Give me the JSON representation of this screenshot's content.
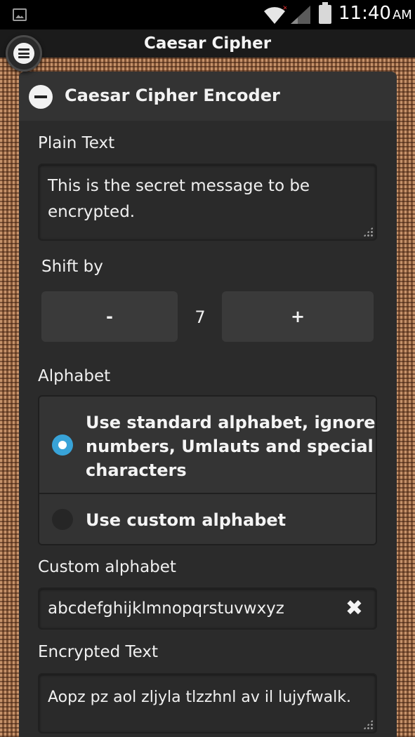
{
  "status_bar": {
    "time": "11:40",
    "ampm": "AM",
    "icons": [
      "image-icon",
      "wifi-icon",
      "signal-icon",
      "battery-icon"
    ]
  },
  "app_bar": {
    "title": "Caesar Cipher",
    "menu_icon": "menu-icon"
  },
  "encoder": {
    "title": "Caesar Cipher Encoder",
    "collapse_icon": "minus-icon",
    "plain_text_label": "Plain Text",
    "plain_text_line1": "This is the secret message to be",
    "plain_text_line2": "encrypted.",
    "shift_label": "Shift by",
    "minus_label": "-",
    "shift_value": "7",
    "plus_label": "+",
    "alphabet_label": "Alphabet",
    "options": [
      {
        "line1": "Use standard alphabet, ignore",
        "line2": "numbers, Umlauts and special",
        "line3": "characters",
        "selected": true
      },
      {
        "label": "Use custom alphabet",
        "selected": false
      }
    ],
    "custom_alphabet_label": "Custom alphabet",
    "custom_alphabet_value": "abcdefghijklmnopqrstuvwxyz",
    "clear_symbol": "✖",
    "encrypted_label": "Encrypted Text",
    "encrypted_value": "Aopz pz aol zljyla tlzzhnl av il lujyfwalk."
  },
  "colors": {
    "accent": "#38a3d8",
    "panel": "#2b2b2b",
    "app_bar": "#1b1b1b"
  }
}
